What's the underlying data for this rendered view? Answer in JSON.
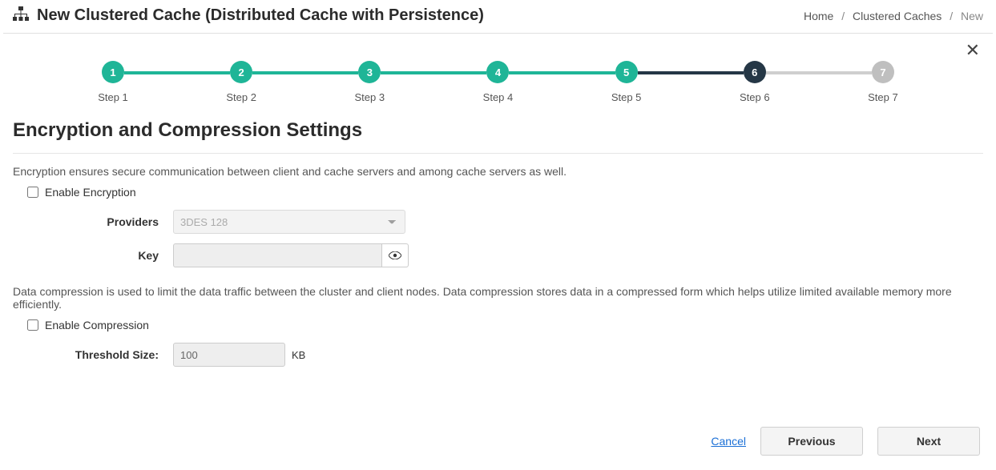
{
  "header": {
    "title": "New Clustered Cache (Distributed Cache with Persistence)"
  },
  "breadcrumb": {
    "home": "Home",
    "mid": "Clustered Caches",
    "current": "New"
  },
  "stepper": {
    "steps": [
      {
        "num": "1",
        "label": "Step 1",
        "state": "done"
      },
      {
        "num": "2",
        "label": "Step 2",
        "state": "done"
      },
      {
        "num": "3",
        "label": "Step 3",
        "state": "done"
      },
      {
        "num": "4",
        "label": "Step 4",
        "state": "done"
      },
      {
        "num": "5",
        "label": "Step 5",
        "state": "done"
      },
      {
        "num": "6",
        "label": "Step 6",
        "state": "current"
      },
      {
        "num": "7",
        "label": "Step 7",
        "state": "future"
      }
    ]
  },
  "section": {
    "title": "Encryption and Compression Settings",
    "encryption_desc": "Encryption ensures secure communication between client and cache servers and among cache servers as well.",
    "enable_encryption_label": "Enable Encryption",
    "providers_label": "Providers",
    "providers_value": "3DES 128",
    "key_label": "Key",
    "key_value": "",
    "compression_desc": "Data compression is used to limit the data traffic between the cluster and client nodes. Data compression stores data in a compressed form which helps utilize limited available memory more efficiently.",
    "enable_compression_label": "Enable Compression",
    "threshold_label": "Threshold Size:",
    "threshold_value": "100",
    "threshold_unit": "KB"
  },
  "footer": {
    "cancel": "Cancel",
    "previous": "Previous",
    "next": "Next"
  }
}
